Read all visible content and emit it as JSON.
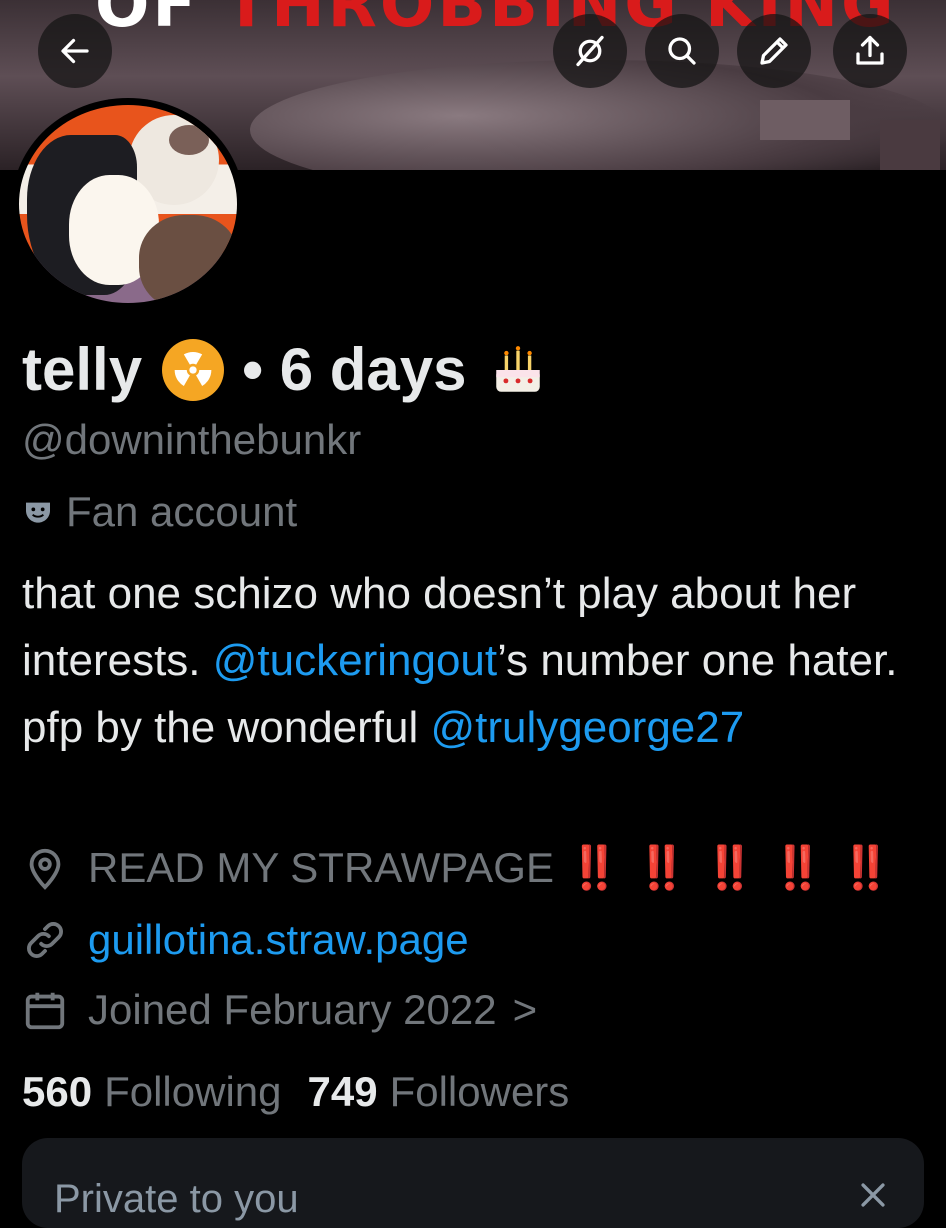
{
  "banner": {
    "text_white": "OF",
    "text_red": "THROBBING KING"
  },
  "nav": {
    "back_icon": "back-arrow-icon",
    "grok_icon": "grok-icon",
    "search_icon": "search-icon",
    "edit_icon": "edit-pencil-icon",
    "share_icon": "share-icon"
  },
  "profile": {
    "display_name": "telly",
    "name_emoji": "radioactive-emoji",
    "birthday_text": "• 6 days",
    "birthday_emoji": "birthday-cake-emoji",
    "handle": "@downinthebunkr",
    "category_icon": "theater-mask-icon",
    "category": "Fan account",
    "bio": {
      "part1": "that one schizo who doesn’t play about her interests. ",
      "mention1": "@tuckeringout",
      "part2": "’s number one hater. pfp by the wonderful ",
      "mention2": "@trulygeorge27"
    },
    "location": "READ MY STRAWPAGE",
    "location_alerts": "‼️ ‼️ ‼️ ‼️ ‼️",
    "website": "guillotina.straw.page",
    "joined": "Joined February 2022",
    "joined_chevron": ">"
  },
  "stats": {
    "following_count": "560",
    "following_label": "Following",
    "followers_count": "749",
    "followers_label": "Followers"
  },
  "private_card": {
    "title": "Private to you"
  },
  "colors": {
    "accent": "#1d9bf0",
    "muted": "#71767b",
    "alert": "#e0261f",
    "background": "#000000"
  }
}
